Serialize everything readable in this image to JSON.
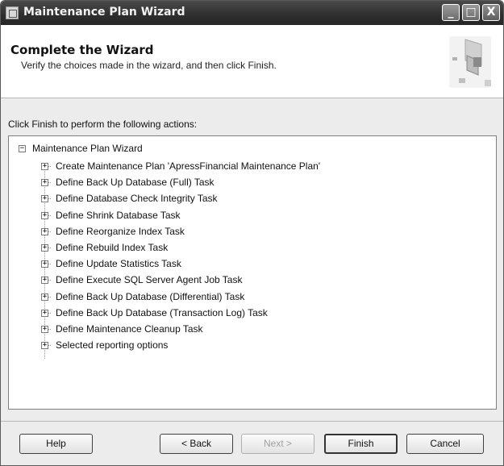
{
  "window": {
    "title": "Maintenance Plan Wizard",
    "controls": {
      "minimize": "_",
      "maximize": "□",
      "close": "X"
    }
  },
  "header": {
    "title": "Complete the Wizard",
    "subtitle": "Verify the choices made in the wizard, and then click Finish."
  },
  "instruction": "Click Finish to perform the following actions:",
  "tree": {
    "root": "Maintenance Plan Wizard",
    "items": [
      "Create Maintenance Plan 'ApressFinancial Maintenance Plan'",
      "Define Back Up Database (Full) Task",
      "Define Database Check Integrity Task",
      "Define Shrink Database Task",
      "Define Reorganize Index Task",
      "Define Rebuild Index Task",
      "Define Update Statistics Task",
      "Define Execute SQL Server Agent Job Task",
      "Define Back Up Database (Differential) Task",
      "Define Back Up Database (Transaction Log) Task",
      "Define Maintenance Cleanup Task",
      "Selected reporting options"
    ]
  },
  "buttons": {
    "help": "Help",
    "back": "< Back",
    "next": "Next >",
    "finish": "Finish",
    "cancel": "Cancel"
  }
}
